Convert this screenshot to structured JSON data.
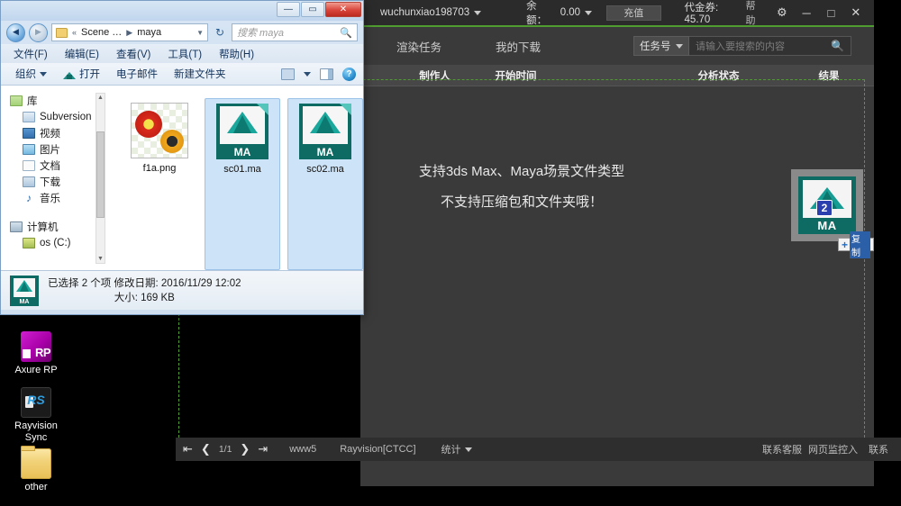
{
  "desktop": {
    "icons": [
      {
        "name": "axure-rp",
        "label": "Axure RP"
      },
      {
        "name": "rayvision-sync",
        "label": "Rayvision\nSync",
        "label_l1": "Rayvision",
        "label_l2": "Sync"
      },
      {
        "name": "other-folder",
        "label": "other"
      }
    ]
  },
  "app": {
    "titlebar": {
      "username": "wuchunxiao198703",
      "balance_label": "余额：",
      "balance_value": "0.00",
      "recharge_label": "充值",
      "voucher_label": "代金券:",
      "voucher_value": "45.70",
      "help_label": "帮助",
      "gear_icon": "gear-icon",
      "minimize_icon": "minimize-icon",
      "maximize_icon": "maximize-icon",
      "close_icon": "close-icon"
    },
    "nav": {
      "tabs": [
        {
          "label": "渲染任务",
          "name": "tab-render-tasks"
        },
        {
          "label": "我的下载",
          "name": "tab-my-downloads"
        }
      ],
      "filter_selected": "任务号",
      "search_placeholder": "请输入要搜索的内容",
      "search_value": ""
    },
    "table": {
      "columns": [
        "",
        "制作人",
        "开始时间",
        "",
        "分析状态",
        "结果"
      ]
    },
    "dropzone": {
      "line1": "支持3ds Max、Maya场景文件类型",
      "line2": "不支持压缩包和文件夹哦！",
      "badge_count": "2",
      "icon_label": "MA",
      "copy_tip_plus": "+",
      "copy_tip_label": "复制",
      "border_color": "#4f9d30"
    },
    "footer": {
      "first_icon": "first-page-icon",
      "prev_icon": "prev-page-icon",
      "page": "1/1",
      "next_icon": "next-page-icon",
      "last_icon": "last-page-icon",
      "node": "www5",
      "line": "Rayvision[CTCC]",
      "stats": "统计",
      "support": "联系客服",
      "monitor": "网页监控入",
      "right_truncated": "联系"
    }
  },
  "explorer": {
    "title": "",
    "window_buttons": {
      "minimize": "—",
      "maximize": "▭",
      "close": "✕"
    },
    "address": {
      "crumb_sep": "«",
      "crumb1": "Scene …",
      "crumb_arrow": "▶",
      "crumb2": "maya",
      "search_placeholder": "搜索 maya"
    },
    "menu": [
      "文件(F)",
      "编辑(E)",
      "查看(V)",
      "工具(T)",
      "帮助(H)"
    ],
    "toolbar": {
      "organize": "组织",
      "open": "打开",
      "email": "电子邮件",
      "new_folder": "新建文件夹"
    },
    "sidebar": [
      {
        "label": "库",
        "icon": "library-icon",
        "level": 0
      },
      {
        "label": "Subversion",
        "icon": "subversion-icon",
        "level": 1
      },
      {
        "label": "视频",
        "icon": "video-icon",
        "level": 1
      },
      {
        "label": "图片",
        "icon": "pictures-icon",
        "level": 1
      },
      {
        "label": "文档",
        "icon": "documents-icon",
        "level": 1
      },
      {
        "label": "下载",
        "icon": "downloads-icon",
        "level": 1
      },
      {
        "label": "音乐",
        "icon": "music-icon",
        "level": 1
      },
      {
        "label": "计算机",
        "icon": "computer-icon",
        "level": 0
      },
      {
        "label": "os (C:)",
        "icon": "harddisk-icon",
        "level": 1
      }
    ],
    "files": [
      {
        "name": "f1a.png",
        "type": "png",
        "selected": false
      },
      {
        "name": "sc01.ma",
        "type": "ma",
        "selected": true
      },
      {
        "name": "sc02.ma",
        "type": "ma",
        "selected": true
      }
    ],
    "status": {
      "line1": "已选择 2 个项  修改日期: 2016/11/29 12:02",
      "line2": "大小: 169 KB"
    }
  }
}
